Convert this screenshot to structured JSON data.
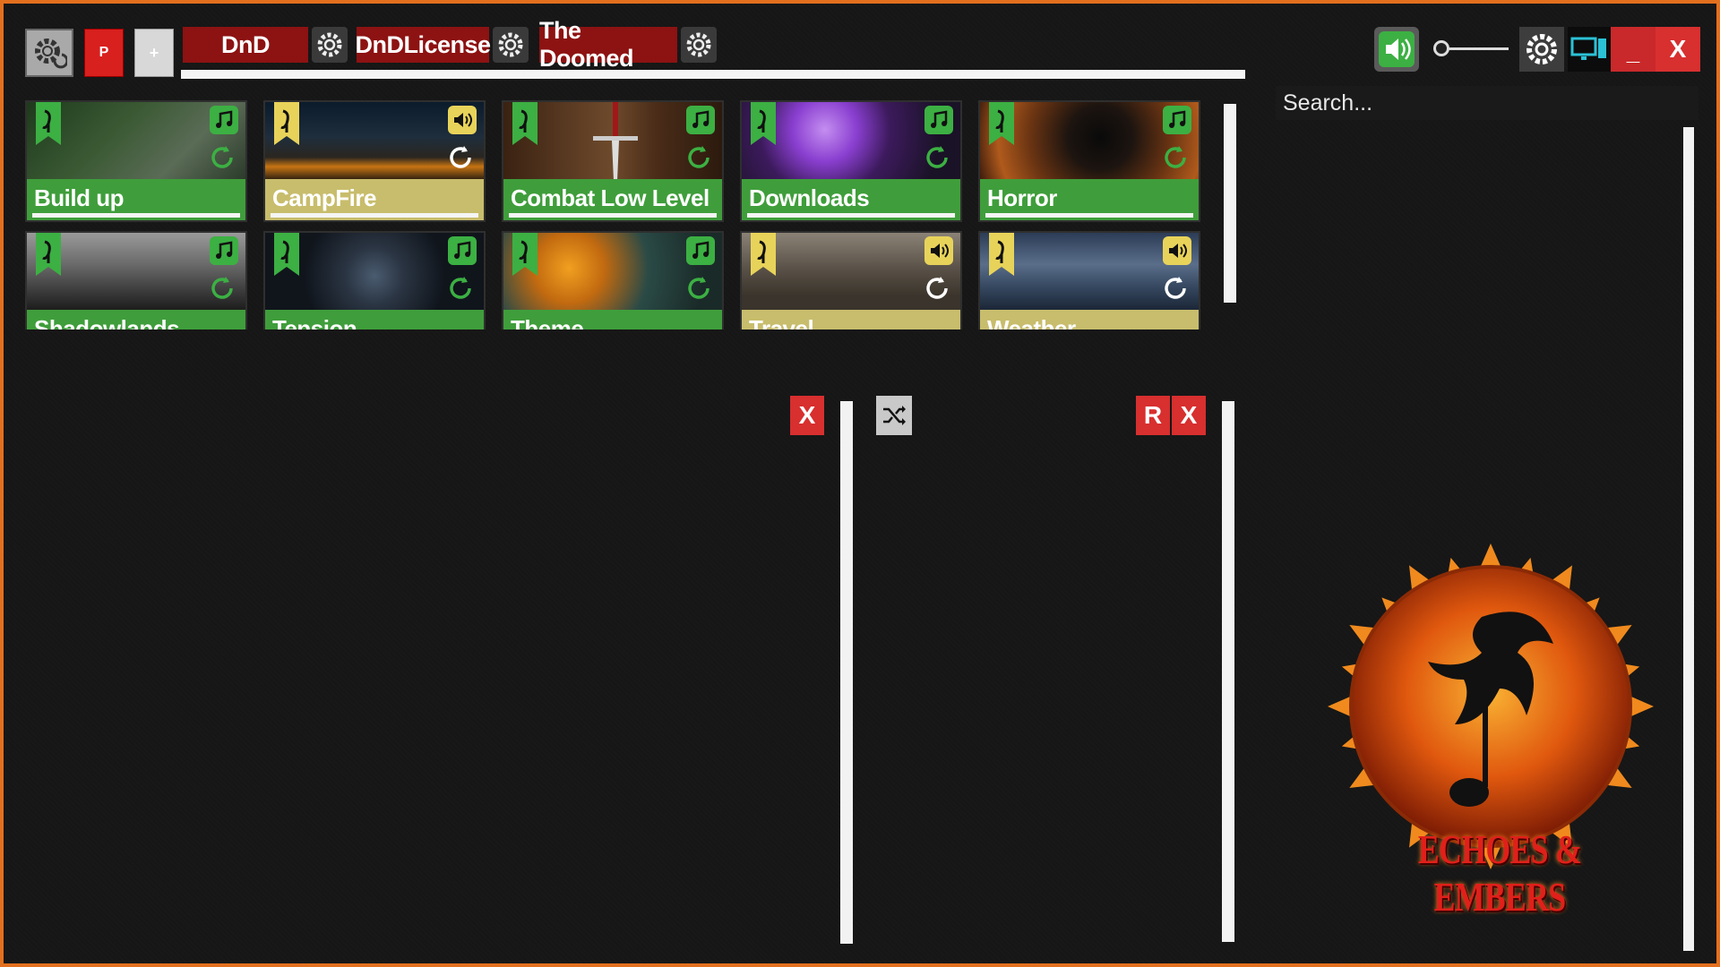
{
  "toolbar": {
    "p_label": "P",
    "plus_label": "+",
    "tabs": [
      {
        "label": "DnD"
      },
      {
        "label": "DnDLicense"
      },
      {
        "label": "The Doomed"
      }
    ]
  },
  "window": {
    "minimize_label": "_",
    "close_label": "X"
  },
  "search": {
    "placeholder": "Search..."
  },
  "tiles": [
    {
      "label": "Build up",
      "theme": "green",
      "icon": "music-note-icon"
    },
    {
      "label": "CampFire",
      "theme": "beige",
      "icon": "speaker-icon"
    },
    {
      "label": "Combat Low Level",
      "theme": "green",
      "icon": "music-note-icon"
    },
    {
      "label": "Downloads",
      "theme": "green",
      "icon": "music-note-icon"
    },
    {
      "label": "Horror",
      "theme": "green",
      "icon": "music-note-icon"
    },
    {
      "label": "Shadowlands",
      "theme": "green",
      "icon": "music-note-icon"
    },
    {
      "label": "Tension",
      "theme": "green",
      "icon": "music-note-icon"
    },
    {
      "label": "Theme",
      "theme": "green",
      "icon": "music-note-icon"
    },
    {
      "label": "Travel",
      "theme": "beige",
      "icon": "speaker-icon"
    },
    {
      "label": "Weather",
      "theme": "beige",
      "icon": "speaker-icon"
    }
  ],
  "panels": {
    "left_clear_label": "X",
    "right_r_label": "R",
    "right_clear_label": "X"
  },
  "logo": {
    "text": "ECHOES & EMBERS"
  },
  "colors": {
    "frame": "#e2701e",
    "tile_green": "#3f9e3b",
    "tile_beige": "#c8bd6c",
    "tab_red": "#8d1212",
    "button_red": "#d82f2f"
  }
}
